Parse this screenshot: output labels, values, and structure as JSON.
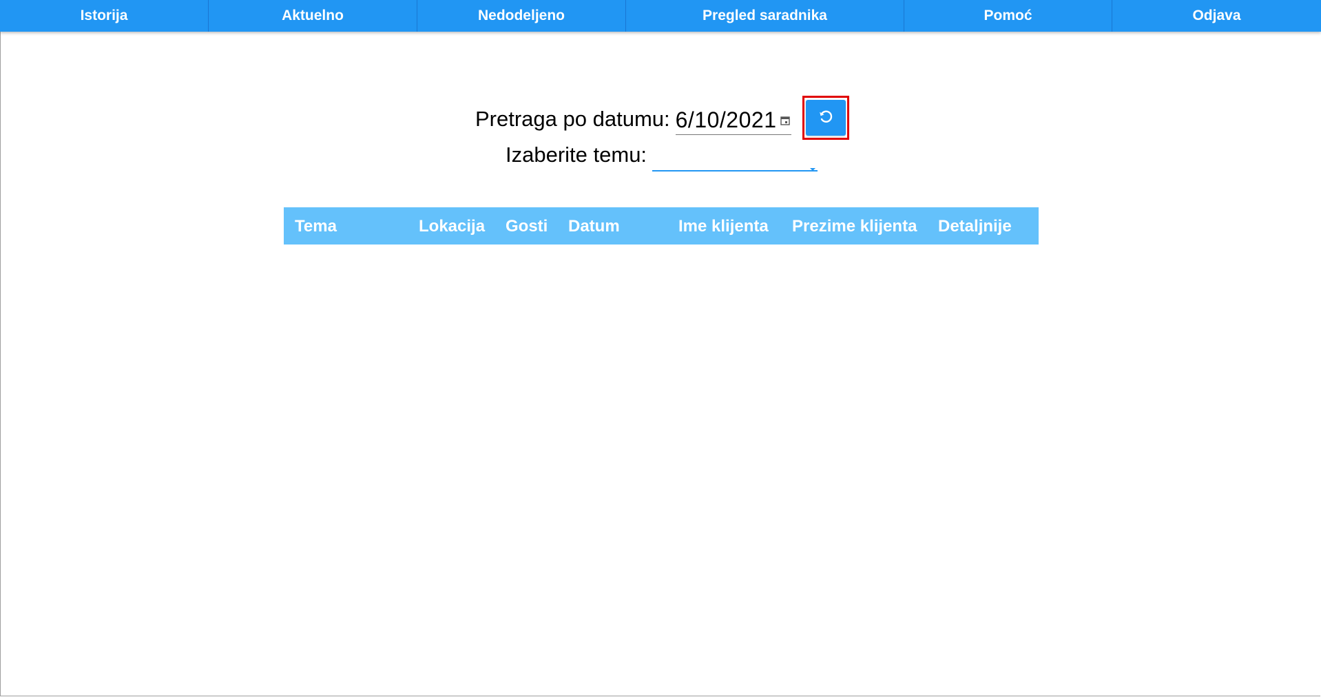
{
  "nav": {
    "items": [
      {
        "label": "Istorija"
      },
      {
        "label": "Aktuelno"
      },
      {
        "label": "Nedodeljeno"
      },
      {
        "label": "Pregled saradnika"
      },
      {
        "label": "Pomoć"
      },
      {
        "label": "Odjava"
      }
    ]
  },
  "filters": {
    "date_label": "Pretraga po datumu:",
    "date_value": "6/10/2021",
    "topic_label": "Izaberite temu:",
    "topic_value": ""
  },
  "table": {
    "columns": [
      "Tema",
      "Lokacija",
      "Gosti",
      "Datum",
      "Ime klijenta",
      "Prezime klijenta",
      "Detaljnije"
    ],
    "rows": []
  },
  "icons": {
    "calendar": "calendar-icon",
    "refresh": "refresh-icon",
    "dropdown": "dropdown-arrow-icon"
  },
  "colors": {
    "primary": "#2196f3",
    "table_header": "#64c1fb",
    "highlight": "#e00000"
  }
}
